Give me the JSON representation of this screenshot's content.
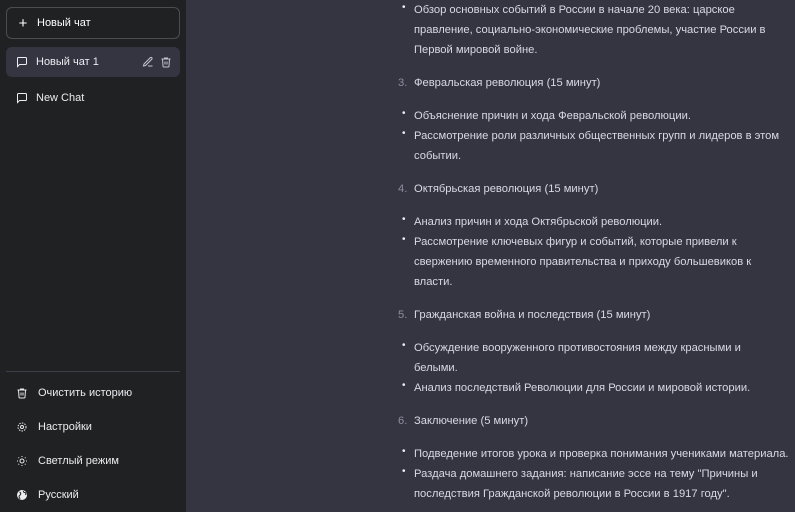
{
  "sidebar": {
    "new_chat_label": "Новый чат",
    "chats": [
      {
        "label": "Новый чат 1",
        "active": true
      },
      {
        "label": "New Chat",
        "active": false
      }
    ],
    "bottom": {
      "clear_history": "Очистить историю",
      "settings": "Настройки",
      "light_mode": "Светлый режим",
      "language": "Русский"
    }
  },
  "content": {
    "intro_bullet_lines": [
      "Обзор основных событий в России в начале 20 века: царское",
      "правление, социально-экономические проблемы, участие России в",
      "Первой мировой войне."
    ],
    "sections": [
      {
        "num": "3.",
        "title": "Февральская революция (15 минут)",
        "bullets": [
          [
            "Объяснение причин и хода Февральской революции."
          ],
          [
            "Рассмотрение роли различных общественных групп и лидеров в этом",
            "событии."
          ]
        ]
      },
      {
        "num": "4.",
        "title": "Октябрьская революция (15 минут)",
        "bullets": [
          [
            "Анализ причин и хода Октябрьской революции."
          ],
          [
            "Рассмотрение ключевых фигур и событий, которые привели к",
            "свержению временного правительства и приходу большевиков к",
            "власти."
          ]
        ]
      },
      {
        "num": "5.",
        "title": "Гражданская война и последствия (15 минут)",
        "bullets": [
          [
            "Обсуждение вооруженного противостояния между красными и",
            "белыми."
          ],
          [
            "Анализ последствий Революции для России и мировой истории."
          ]
        ]
      },
      {
        "num": "6.",
        "title": "Заключение (5 минут)",
        "bullets": [
          [
            "Подведение итогов урока и проверка понимания учениками материала."
          ],
          [
            "Раздача домашнего задания: написание эссе на тему \"Причины и",
            "последствия Гражданской революции в России в 1917 году\"."
          ]
        ]
      }
    ]
  },
  "icons": {
    "new_chat": "plus-icon",
    "chat": "message-square-icon",
    "edit": "pencil-icon",
    "delete": "trash-icon",
    "clear_history": "trash-icon",
    "settings": "gear-icon",
    "light_mode": "sun-icon",
    "language": "globe-icon"
  },
  "colors": {
    "sidebar_bg": "#202123",
    "main_bg": "#343541",
    "text": "#ececf1",
    "muted": "#8e8ea0"
  }
}
